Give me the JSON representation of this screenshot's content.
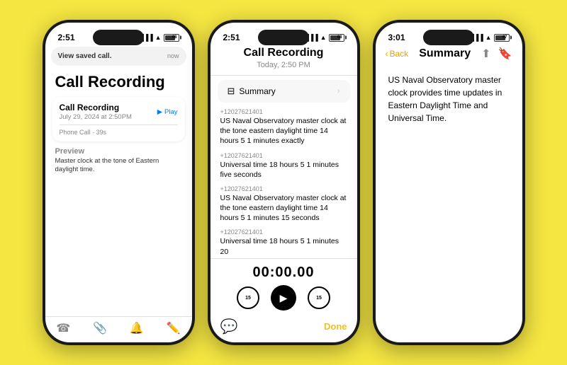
{
  "bg_color": "#f5e642",
  "phone1": {
    "status_time": "2:51",
    "notification": {
      "text": "View saved call.",
      "time": "now"
    },
    "app_title": "Call Recording",
    "recording": {
      "name": "Call Recording",
      "date": "July 29, 2024 at 2:50PM",
      "duration": "Phone Call · 39s",
      "play_label": "Play"
    },
    "preview_label": "Preview",
    "preview_text": "Master clock at the tone of Eastern daylight time.",
    "tabs": [
      {
        "icon": "☎",
        "label": ""
      },
      {
        "icon": "📎",
        "label": ""
      },
      {
        "icon": "🔔",
        "label": ""
      },
      {
        "icon": "✏️",
        "label": ""
      }
    ]
  },
  "phone2": {
    "status_time": "2:51",
    "title": "Call Recording",
    "date": "Today, 2:50 PM",
    "summary_label": "Summary",
    "transcript": [
      {
        "number": "+12027621401",
        "text": "US Naval Observatory master clock at the tone eastern daylight time 14 hours 5 1 minutes exactly"
      },
      {
        "number": "+12027621401",
        "text": "Universal time 18 hours 5 1 minutes five seconds"
      },
      {
        "number": "+12027621401",
        "text": "US Naval Observatory master clock at the tone eastern daylight time 14 hours 5 1 minutes 15 seconds"
      },
      {
        "number": "+12027621401",
        "text": "Universal time 18 hours 5 1 minutes 20"
      }
    ],
    "player_time": "00:00.00",
    "done_label": "Done",
    "skip_back": "15",
    "skip_fwd": "15"
  },
  "phone3": {
    "status_time": "3:01",
    "back_label": "Back",
    "title": "Summary",
    "summary_text": "US Naval Observatory master clock provides time updates in Eastern Daylight Time and Universal Time."
  }
}
